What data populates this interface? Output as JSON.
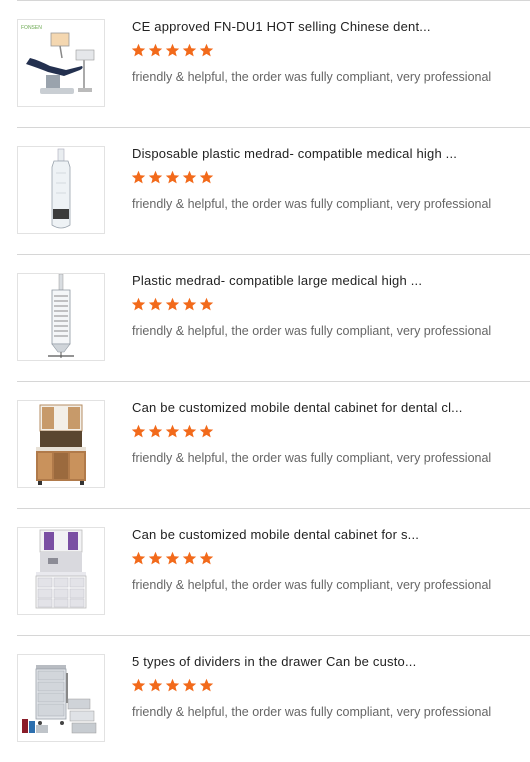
{
  "reviews": [
    {
      "title": "CE approved FN-DU1 HOT selling Chinese dent...",
      "rating": 5,
      "comment": "friendly & helpful, the order was fully compliant, very professional",
      "image_icon": "dental-chair-icon",
      "image_brand": "FONSEN"
    },
    {
      "title": "Disposable plastic medrad- compatible medical high ...",
      "rating": 5,
      "comment": "friendly & helpful, the order was fully compliant, very professional",
      "image_icon": "syringe-icon"
    },
    {
      "title": "Plastic medrad- compatible large medical high ...",
      "rating": 5,
      "comment": "friendly & helpful, the order was fully compliant, very professional",
      "image_icon": "syringe-icon"
    },
    {
      "title": "Can be customized mobile dental cabinet for dental cl...",
      "rating": 5,
      "comment": "friendly & helpful, the order was fully compliant, very professional",
      "image_icon": "wood-cabinet-icon"
    },
    {
      "title": "Can be customized mobile dental cabinet for s...",
      "rating": 5,
      "comment": "friendly & helpful, the order was fully compliant, very professional",
      "image_icon": "white-cabinet-icon"
    },
    {
      "title": "5 types of dividers in the drawer Can be custo...",
      "rating": 5,
      "comment": "friendly & helpful, the order was fully compliant, very professional",
      "image_icon": "drawer-trolley-icon"
    }
  ],
  "colors": {
    "star": "#f26a1b",
    "divider": "#d6d6d6",
    "title": "#222222",
    "comment": "#666666"
  }
}
